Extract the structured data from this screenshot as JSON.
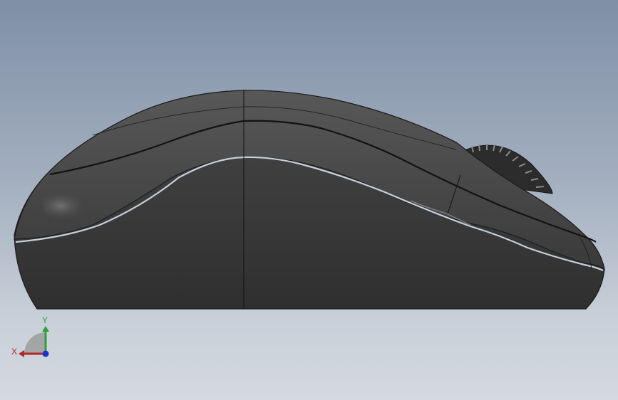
{
  "view": {
    "background_top": "#7f8fa6",
    "background_bottom": "#d4d9e0",
    "model_color": "#3c3c3c"
  },
  "triad": {
    "x_label": "X",
    "y_label": "Y",
    "x_color": "#b0282a",
    "y_color": "#2e9e3c",
    "z_color": "#2233cc"
  }
}
